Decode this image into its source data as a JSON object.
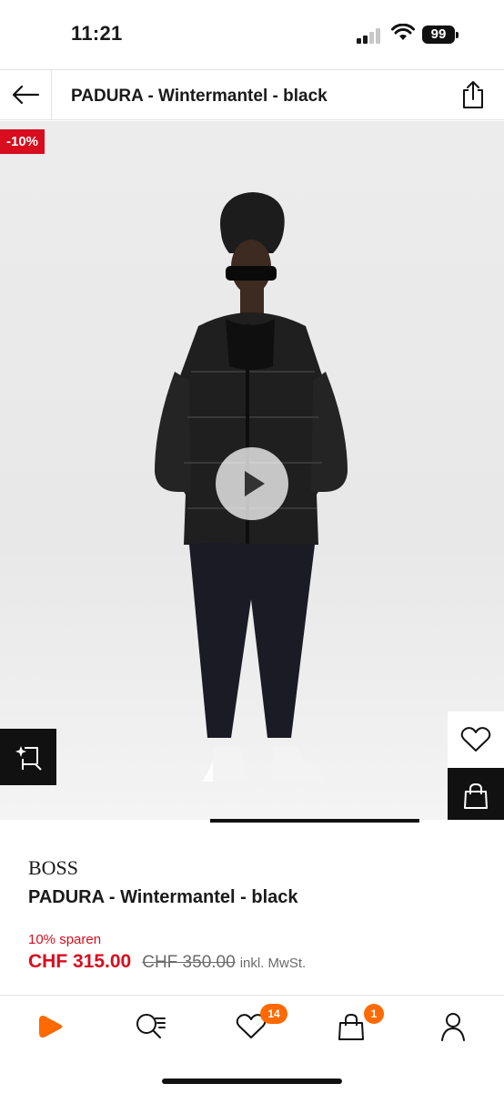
{
  "status": {
    "time": "11:21",
    "battery": "99"
  },
  "header": {
    "title": "PADURA - Wintermantel - black"
  },
  "hero": {
    "discount_badge": "-10%",
    "gallery_progress": 0.42
  },
  "product": {
    "brand": "BOSS",
    "name": "PADURA - Wintermantel - black",
    "save_text": "10% sparen",
    "price": "CHF 315.00",
    "old_price": "CHF 350.00",
    "tax_note": "inkl. MwSt."
  },
  "nav": {
    "wishlist_count": "14",
    "cart_count": "1"
  },
  "colors": {
    "accent": "#ff6900",
    "sale": "#d80d1d"
  }
}
